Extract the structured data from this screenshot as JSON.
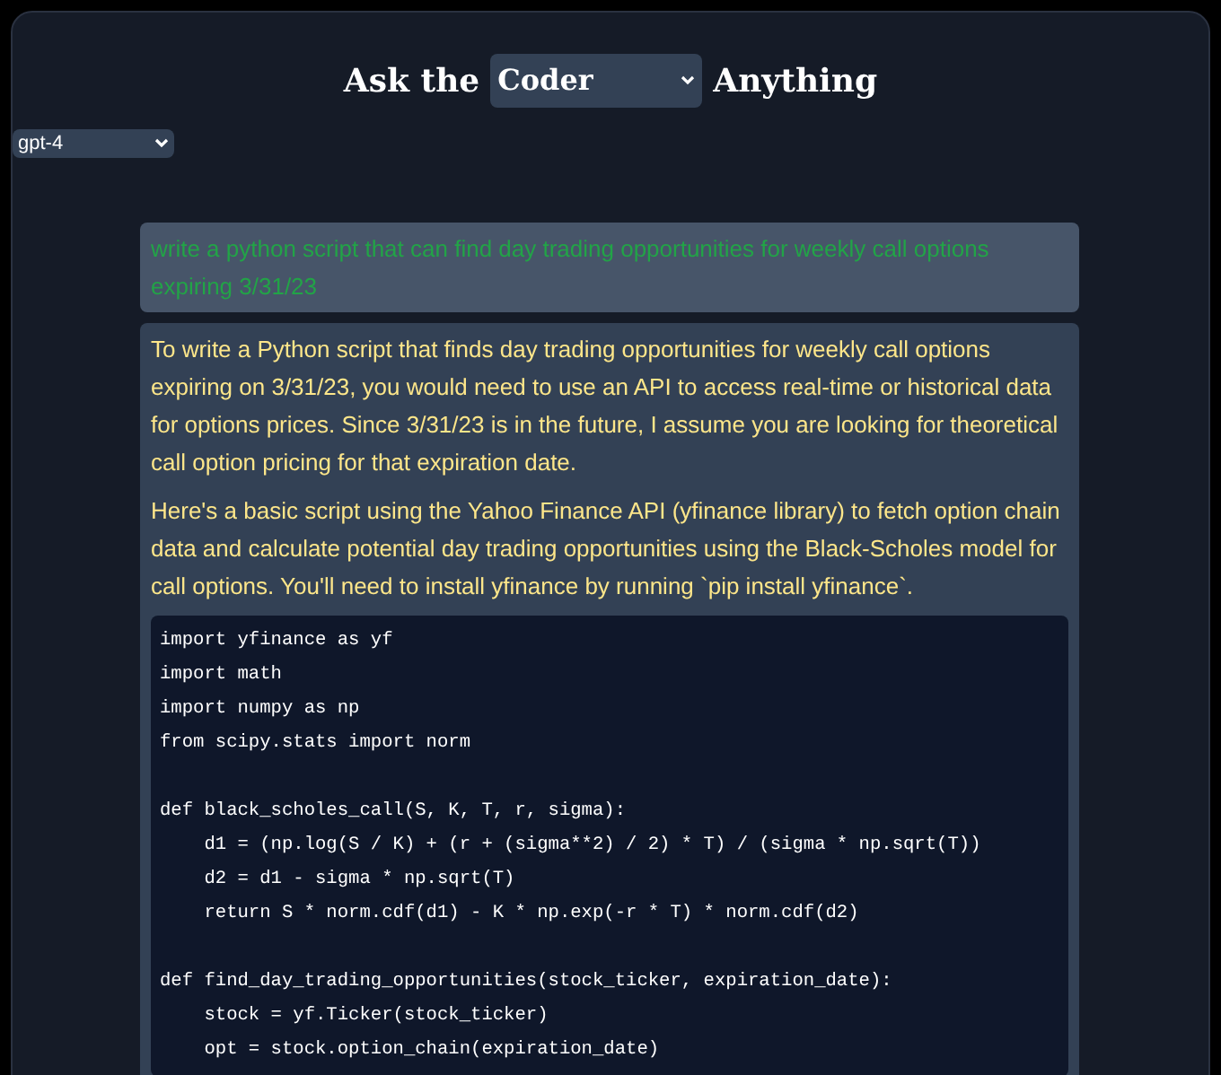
{
  "header": {
    "title_before": "Ask the",
    "persona_select": "Coder",
    "title_after": "Anything"
  },
  "model_select": "gpt-4",
  "messages": [
    {
      "kind": "user",
      "text": "write a python script that can find day trading opportunities for weekly call options expiring 3/31/23"
    },
    {
      "kind": "assistant",
      "paragraphs": [
        "To write a Python script that finds day trading opportunities for weekly call options expiring on 3/31/23, you would need to use an API to access real-time or historical data for options prices. Since 3/31/23 is in the future, I assume you are looking for theoretical call option pricing for that expiration date.",
        "Here's a basic script using the Yahoo Finance API (yfinance library) to fetch option chain data and calculate potential day trading opportunities using the Black-Scholes model for call options. You'll need to install yfinance by running `pip install yfinance`."
      ],
      "code": "import yfinance as yf\nimport math\nimport numpy as np\nfrom scipy.stats import norm\n\ndef black_scholes_call(S, K, T, r, sigma):\n    d1 = (np.log(S / K) + (r + (sigma**2) / 2) * T) / (sigma * np.sqrt(T))\n    d2 = d1 - sigma * np.sqrt(T)\n    return S * norm.cdf(d1) - K * np.exp(-r * T) * norm.cdf(d2)\n\ndef find_day_trading_opportunities(stock_ticker, expiration_date):\n    stock = yf.Ticker(stock_ticker)\n    opt = stock.option_chain(expiration_date)"
    }
  ]
}
